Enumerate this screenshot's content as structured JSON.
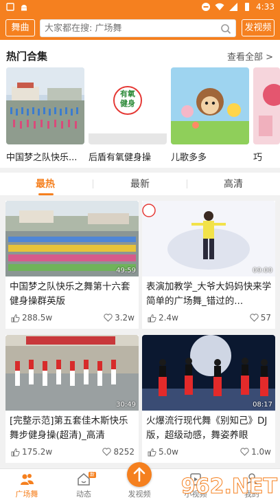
{
  "status_bar": {
    "time": "4:33"
  },
  "header": {
    "dance_button": "舞曲",
    "search_placeholder": "大家都在搜: 广场舞",
    "post_button": "发视频"
  },
  "hot": {
    "title": "热门合集",
    "more": "查看全部 >",
    "items": [
      {
        "label": "中国梦之队快乐..."
      },
      {
        "label": "后盾有氧健身操",
        "logo_text": "有氧健身"
      },
      {
        "label": "儿歌多多"
      },
      {
        "label": "巧"
      }
    ]
  },
  "tabs": [
    {
      "label": "最热"
    },
    {
      "label": "最新"
    },
    {
      "label": "高清"
    }
  ],
  "videos": [
    {
      "title": "中国梦之队快乐之舞第十六套健身操群英版",
      "duration": "49:59",
      "likes": "288.5w",
      "favs": "3.2w"
    },
    {
      "title": "表演加教学_大爷大妈妈快来学简单的广场舞_错过的...",
      "duration": "09:00",
      "likes": "2.4w",
      "favs": "57"
    },
    {
      "title": "[完整示范]第五套佳木斯快乐舞步健身操(超清)_高清",
      "duration": "30:49",
      "likes": "175.2w",
      "favs": "8252"
    },
    {
      "title": "火爆流行现代舞《别知己》DJ版，超级动感，舞姿养眼",
      "duration": "08:17",
      "likes": "5.0w",
      "favs": "1.0w"
    }
  ],
  "bottom_nav": [
    {
      "label": "广场舞"
    },
    {
      "label": "动态",
      "badge": "新"
    },
    {
      "label": "发视频"
    },
    {
      "label": "小视频"
    },
    {
      "label": "我的"
    }
  ],
  "watermark": "962.NET",
  "colors": {
    "accent": "#f5801f"
  }
}
